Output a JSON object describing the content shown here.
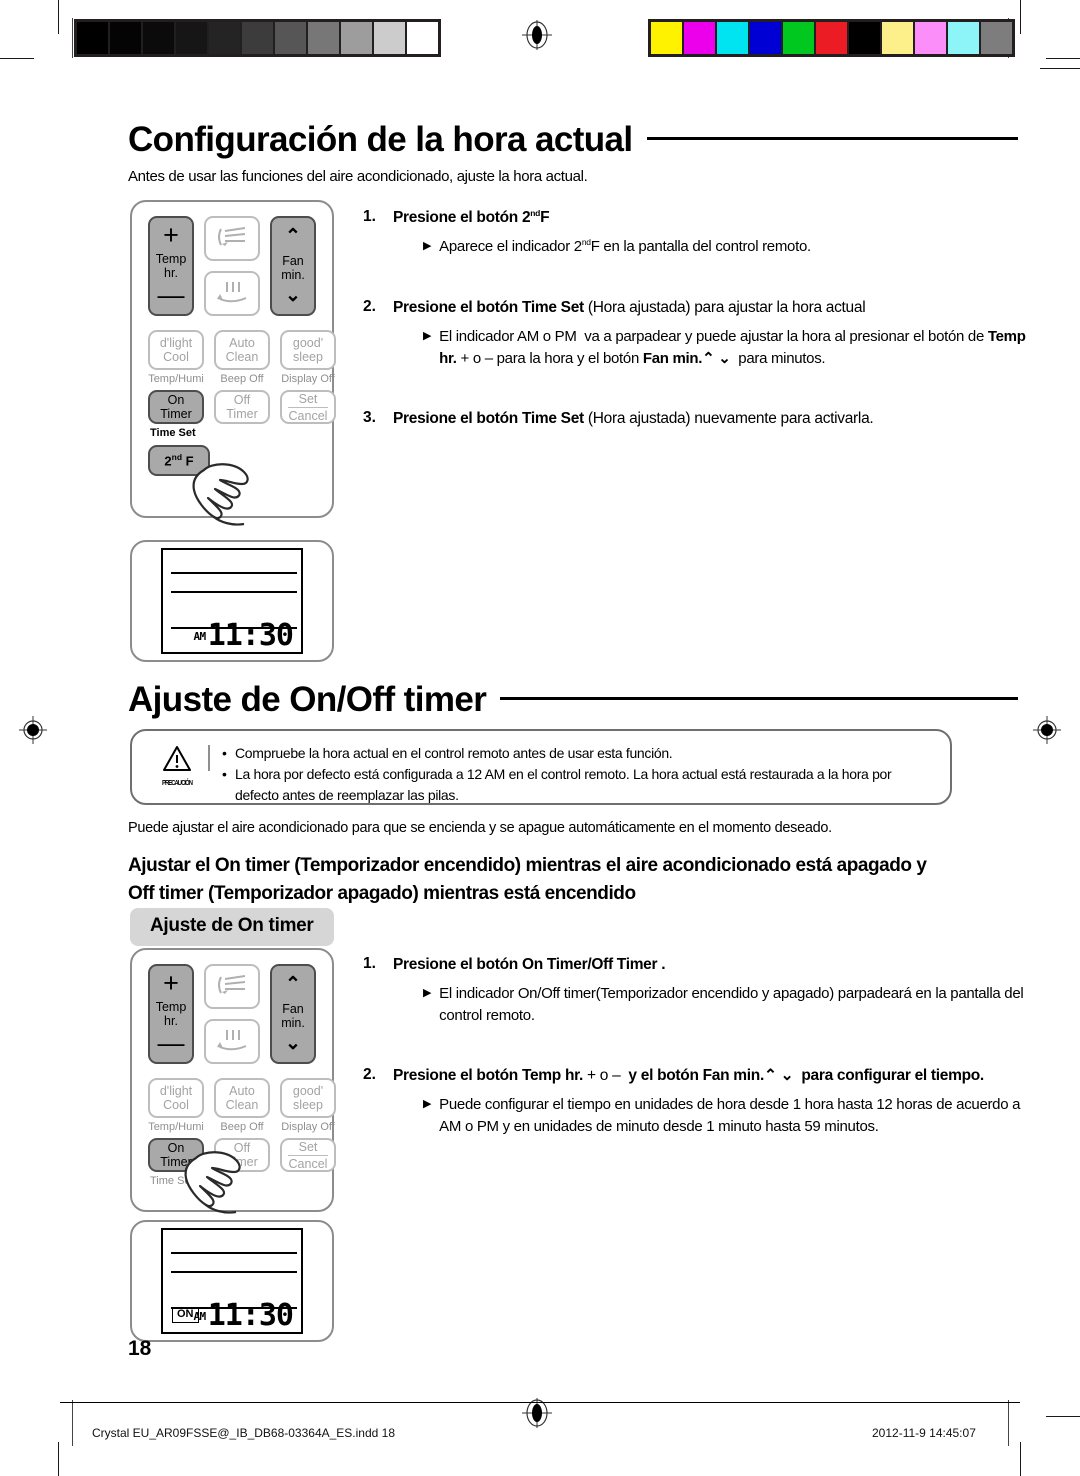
{
  "document": {
    "page_number": "18",
    "footer_file": "Crystal  EU_AR09FSSE@_IB_DB68-03364A_ES.indd   18",
    "footer_timestamp": "2012-11-9   14:45:07"
  },
  "calibration": {
    "grayscale": [
      "#000000",
      "#040404",
      "#0b0b0b",
      "#161616",
      "#242424",
      "#3c3c3c",
      "#565656",
      "#777777",
      "#9d9d9d",
      "#cccccc",
      "#ffffff"
    ],
    "colors": [
      "#fff200",
      "#ec00ec",
      "#00e3f0",
      "#0000d4",
      "#00c81e",
      "#ec1c24",
      "#000000",
      "#fdf08a",
      "#fb8ef9",
      "#8df4f8",
      "#7d7d7d"
    ]
  },
  "section1": {
    "heading": "Configuración de la hora actual",
    "intro": "Antes de usar las funciones del aire acondicionado, ajuste la hora actual.",
    "steps": [
      {
        "num": "1.",
        "title_parts": [
          {
            "t": "Presione el botón ",
            "bold": true
          },
          {
            "t": "2",
            "bold": true
          },
          {
            "t": "nd",
            "sup": true,
            "bold": true
          },
          {
            "t": "F",
            "bold": true
          }
        ],
        "title_plain": "Presione el botón 2ndF",
        "bullets": [
          {
            "parts": [
              {
                "t": "Aparece el indicador 2"
              },
              {
                "t": "nd",
                "sup": true
              },
              {
                "t": "F en la pantalla del control remoto."
              }
            ]
          }
        ]
      },
      {
        "num": "2.",
        "title_plain": "Presione el botón Time Set (Hora ajustada) para ajustar la hora actual",
        "title_parts": [
          {
            "t": "Presione el botón ",
            "bold": true
          },
          {
            "t": "Time Set ",
            "bold": true
          },
          {
            "t": "(Hora ajustada) para ajustar la hora actual",
            "bold": true
          }
        ],
        "bullets": [
          {
            "plain": "El indicador AM o PM  va a parpadear y puede ajustar la hora al presionar el botón de Temp hr. + o – para la hora y el botón Fan min. ⌃ ⌄ para minutos."
          }
        ]
      },
      {
        "num": "3.",
        "title_plain": "Presione el botón Time Set (Hora ajustada) nuevamente para activarla.",
        "bullets": []
      }
    ]
  },
  "section2": {
    "heading": "Ajuste de On/Off timer",
    "caution": {
      "label": "PRECAUCIÓN",
      "icon": "warning-triangle-icon",
      "bullets": [
        "Compruebe la hora actual en el control remoto antes de usar esta función.",
        "La hora por defecto está configurada a 12 AM en el control remoto. La hora actual está restaurada a la hora por defecto antes de reemplazar las pilas."
      ]
    },
    "body": "Puede ajustar el aire acondicionado para que se encienda y se apague automáticamente en el momento deseado.",
    "subheading_line1": "Ajustar el On timer (Temporizador encendido) mientras el aire acondicionado está apagado y",
    "subheading_line2": "Off timer (Temporizador apagado) mientras está encendido",
    "pill": "Ajuste de On timer",
    "steps": [
      {
        "num": "1.",
        "title_plain": "Presione el botón On Timer/Off Timer .",
        "bullets": [
          {
            "plain": "El indicador On/Off timer(Temporizador encendido y apagado) parpadeará en la pantalla del control remoto."
          }
        ]
      },
      {
        "num": "2.",
        "title_plain": "Presione el botón Temp hr. + o –  y el botón Fan min. ⌃ ⌄  para configurar el tiempo.",
        "bullets": [
          {
            "plain": "Puede configurar el tiempo en unidades de hora desde 1 hora hasta 12 horas de acuerdo a AM o PM y en unidades de minuto desde 1 minuto hasta 59 minutos."
          }
        ]
      }
    ]
  },
  "remote": {
    "buttons": {
      "temp_plus": "+",
      "temp_label_1": "Temp",
      "temp_label_2": "hr.",
      "temp_minus": "—",
      "swing_up_icon": "swing-up-icon",
      "swing_down_icon": "swing-down-icon",
      "fan_up_icon": "chevron-up-icon",
      "fan_label_1": "Fan",
      "fan_label_2": "min.",
      "fan_down_icon": "chevron-down-icon",
      "dlight_1": "d'light",
      "dlight_2": "Cool",
      "dlight_cap": "Temp/Humi",
      "auto_1": "Auto",
      "auto_2": "Clean",
      "auto_cap": "Beep Off",
      "good_1": "good'",
      "good_2": "sleep",
      "good_cap": "Display Off",
      "on_1": "On",
      "on_2": "Timer",
      "on_cap": "Time Set",
      "off_1": "Off",
      "off_2": "Timer",
      "set_1": "Set",
      "set_2": "Cancel",
      "secondf": "2ndF",
      "secondf_base": "2",
      "secondf_sup": "nd",
      "secondf_tail": "F"
    },
    "hand_icon": "pointing-hand-icon"
  },
  "lcd1": {
    "ampm": "AM",
    "time": "11:30",
    "on_badge": null
  },
  "lcd2": {
    "ampm": "AM",
    "time": "11:30",
    "on_badge": "ON"
  }
}
